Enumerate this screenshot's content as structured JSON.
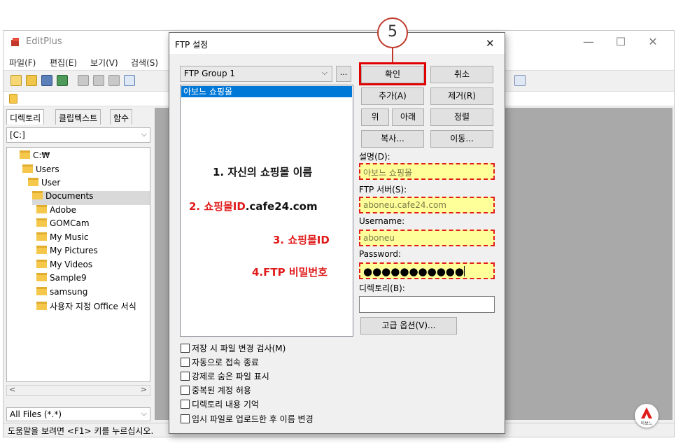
{
  "editplus": {
    "title": "EditPlus",
    "menu": [
      "파일(F)",
      "편집(E)",
      "보기(V)",
      "검색(S)"
    ],
    "left_tabs": [
      "디렉토리",
      "클립텍스트",
      "함수"
    ],
    "drive": "[C:]",
    "tree": [
      "C:₩",
      "Users",
      "User",
      "Documents",
      "Adobe",
      "GOMCam",
      "My Music",
      "My Pictures",
      "My Videos",
      "Sample9",
      "samsung",
      "사용자 지정 Office 서식"
    ],
    "file_filter": "All Files (*.*)",
    "statusbar": "도움말을 보려면 <F1> 키를 누르십시오."
  },
  "dialog": {
    "title": "FTP 설정",
    "group": "FTP Group 1",
    "group_more": "...",
    "sites": [
      "아보느 쇼핑몰"
    ],
    "buttons": {
      "ok": "확인",
      "cancel": "취소",
      "add": "추가(A)",
      "remove": "제거(R)",
      "up": "위",
      "down": "아래",
      "sort": "정렬",
      "copy": "복사...",
      "move": "이동...",
      "advanced": "고급 옵션(V)..."
    },
    "fields": {
      "description_label": "설명(D):",
      "description_value": "아보느 쇼핑몰",
      "server_label": "FTP 서버(S):",
      "server_value": "aboneu.cafe24.com",
      "username_label": "Username:",
      "username_value": "aboneu",
      "password_label": "Password:",
      "password_value": "●●●●●●●●●●●",
      "directory_label": "디렉토리(B):",
      "directory_value": ""
    },
    "checkboxes": [
      "저장 시 파일 변경 검사(M)",
      "자동으로 접속 종료",
      "강제로 숨은 파일 표시",
      "중복된 계정 허용",
      "디렉토리 내용 기억",
      "임시 파일로 업로드한 후 이름 변경"
    ]
  },
  "annotations": {
    "step": "5",
    "note1": "1. 자신의 쇼핑몰 이름",
    "note2_red": "2. 쇼핑몰ID",
    "note2_black": ".cafe24.com",
    "note3": "3. 쇼핑몰ID",
    "note4": "4.FTP 비밀번호",
    "brand": "아보느"
  },
  "colors": {
    "accent_red": "#e01b1b",
    "highlight_yellow": "#ffff99",
    "selection_blue": "#0078d7"
  }
}
